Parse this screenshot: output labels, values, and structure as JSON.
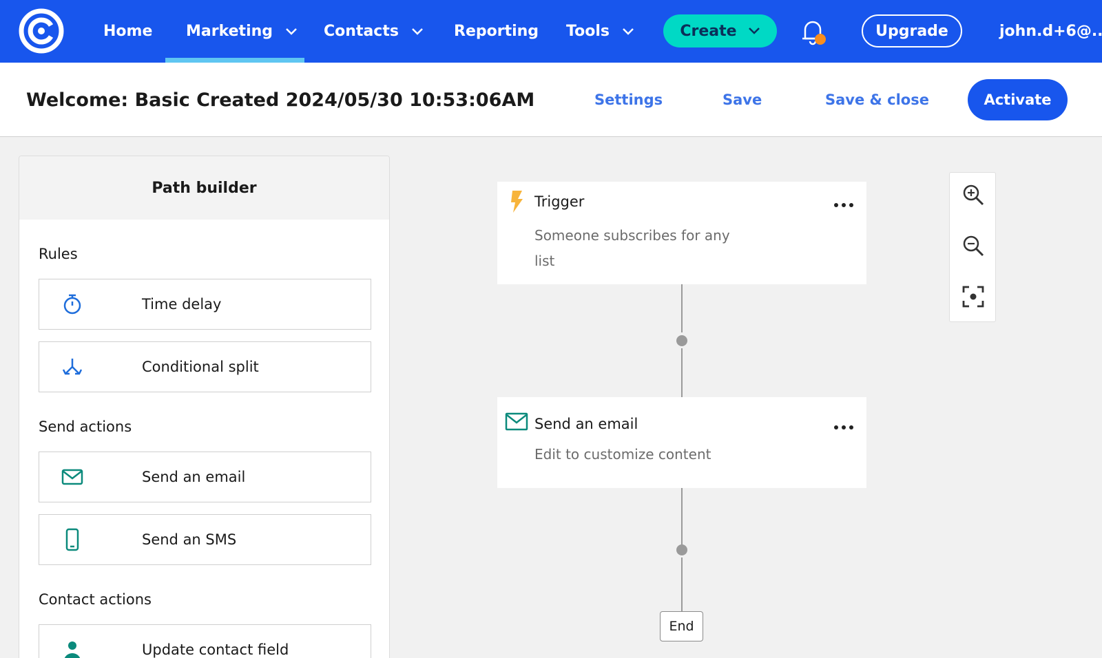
{
  "nav": {
    "items": [
      {
        "label": "Home"
      },
      {
        "label": "Marketing"
      },
      {
        "label": "Contacts"
      },
      {
        "label": "Reporting"
      },
      {
        "label": "Tools"
      }
    ],
    "create_label": "Create",
    "upgrade_label": "Upgrade",
    "user_label": "john.d+6@..."
  },
  "header": {
    "title": "Welcome: Basic Created 2024/05/30 10:53:06AM",
    "settings_label": "Settings",
    "save_label": "Save",
    "save_close_label": "Save & close",
    "activate_label": "Activate"
  },
  "panel": {
    "title": "Path builder",
    "sections": [
      {
        "label": "Rules",
        "items": [
          {
            "label": "Time delay",
            "icon": "stopwatch-icon"
          },
          {
            "label": "Conditional split",
            "icon": "split-icon"
          }
        ]
      },
      {
        "label": "Send actions",
        "items": [
          {
            "label": "Send an email",
            "icon": "envelope-icon"
          },
          {
            "label": "Send an SMS",
            "icon": "phone-icon"
          }
        ]
      },
      {
        "label": "Contact actions",
        "items": [
          {
            "label": "Update contact field",
            "icon": "person-icon"
          }
        ]
      }
    ]
  },
  "canvas": {
    "nodes": [
      {
        "title": "Trigger",
        "desc_line1": "Someone subscribes for any",
        "desc_line2": "list"
      },
      {
        "title": "Send an email",
        "desc_line1": "Edit to customize content"
      }
    ],
    "end_label": "End"
  },
  "colors": {
    "nav_bg": "#1856ed",
    "accent_teal": "#00d9c5",
    "link_blue": "#3d74e8",
    "rule_icon_blue": "#1e6ddb",
    "action_icon_teal": "#0b8a7c",
    "trigger_icon": "#f7b43b",
    "notification_dot": "#f98e1d"
  }
}
